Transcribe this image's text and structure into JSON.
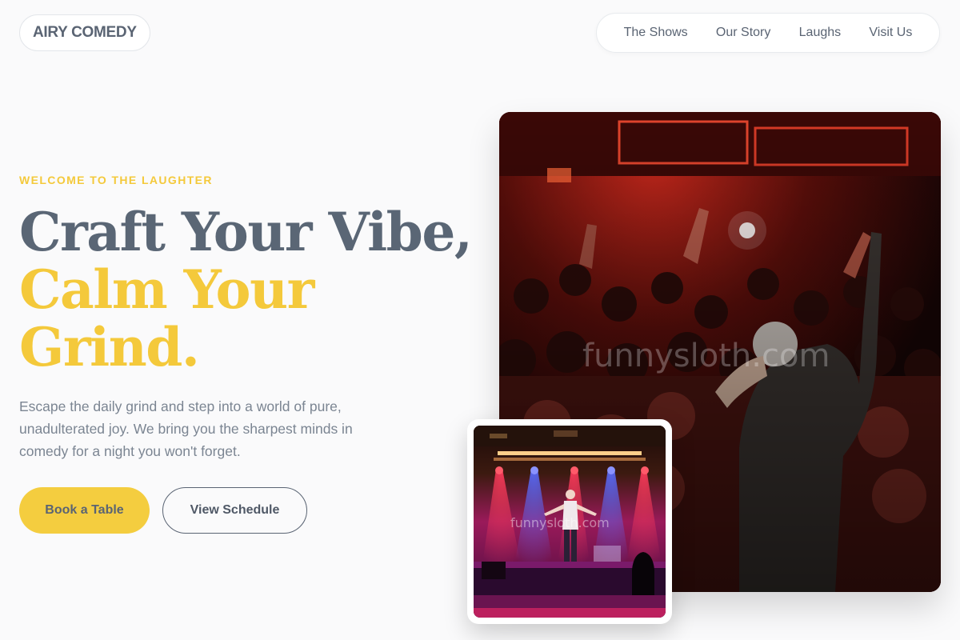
{
  "brand": {
    "name": "AIRY COMEDY"
  },
  "nav": {
    "items": [
      "The Shows",
      "Our Story",
      "Laughs",
      "Visit Us"
    ]
  },
  "hero": {
    "eyebrow": "WELCOME TO THE LAUGHTER",
    "headline_line1": "Craft Your Vibe,",
    "headline_line2a": "Calm Your",
    "headline_line2b": "Grind.",
    "description": "Escape the daily grind and step into a world of pure, unadulterated joy. We bring you the sharpest minds in comedy for a night you won't forget.",
    "cta_primary": "Book a Table",
    "cta_secondary": "View Schedule"
  },
  "images": {
    "main_watermark": "funnysloth.com",
    "inset_watermark": "funnysloth.com"
  },
  "colors": {
    "accent": "#f4c93b",
    "text": "#5a6473",
    "background": "#fafafb"
  }
}
